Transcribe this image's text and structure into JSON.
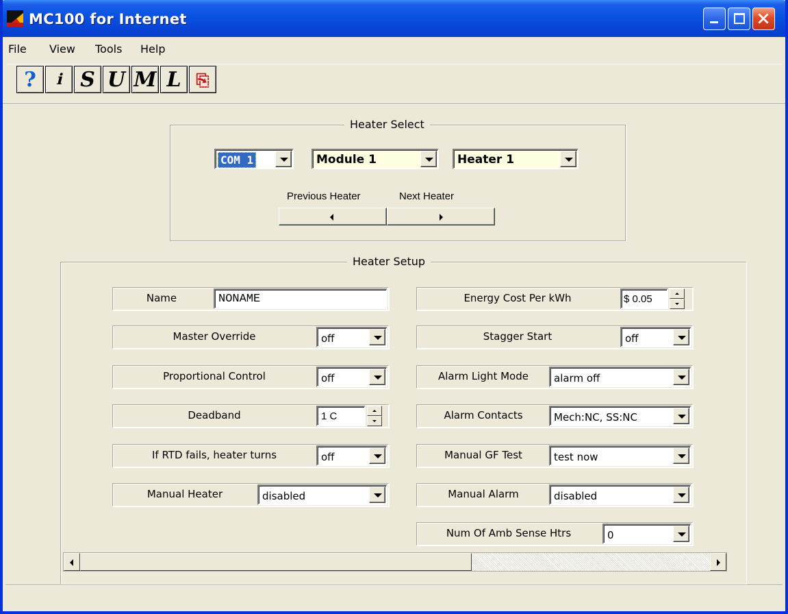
{
  "window": {
    "title": "MC100 for Internet"
  },
  "menu": {
    "items": [
      "File",
      "View",
      "Tools",
      "Help"
    ]
  },
  "toolbar": {
    "buttons": [
      {
        "glyph": "?",
        "icon": "help-icon"
      },
      {
        "glyph": "ℹ",
        "icon": "info-icon"
      },
      {
        "glyph": "S",
        "icon": "setup-icon"
      },
      {
        "glyph": "U",
        "icon": "u-icon"
      },
      {
        "glyph": "M",
        "icon": "m-icon"
      },
      {
        "glyph": "L",
        "icon": "l-icon"
      },
      {
        "glyph": "⎘",
        "icon": "save-export-icon"
      }
    ]
  },
  "heater_select": {
    "legend": "Heater Select",
    "com_port": "COM 1",
    "module": "Module 1",
    "heater": "Heater 1",
    "previous_label": "Previous Heater",
    "next_label": "Next Heater"
  },
  "heater_setup": {
    "legend": "Heater Setup",
    "left": {
      "name_label": "Name",
      "name_value": "NONAME",
      "master_override_label": "Master Override",
      "master_override_value": "off",
      "proportional_label": "Proportional Control",
      "proportional_value": "off",
      "deadband_label": "Deadband",
      "deadband_value": "1 C",
      "rtd_fail_label": "If RTD fails, heater turns",
      "rtd_fail_value": "off",
      "manual_heater_label": "Manual Heater",
      "manual_heater_value": "disabled"
    },
    "right": {
      "energy_cost_label": "Energy Cost Per kWh",
      "energy_cost_value": "$ 0.05",
      "stagger_label": "Stagger Start",
      "stagger_value": "off",
      "alarm_light_label": "Alarm Light Mode",
      "alarm_light_value": "alarm off",
      "alarm_contacts_label": "Alarm Contacts",
      "alarm_contacts_value": "Mech:NC, SS:NC",
      "gf_test_label": "Manual GF Test",
      "gf_test_value": "test now",
      "manual_alarm_label": "Manual Alarm",
      "manual_alarm_value": "disabled",
      "amb_sense_label": "Num Of Amb Sense Htrs",
      "amb_sense_value": "0"
    }
  },
  "colors": {
    "title_bar": "#0a54e2",
    "window_bg": "#ece9d8",
    "selected_combo_bg": "#316ac5",
    "yellow_combo_bg": "#ffffe1",
    "close_button": "#e04a25"
  }
}
